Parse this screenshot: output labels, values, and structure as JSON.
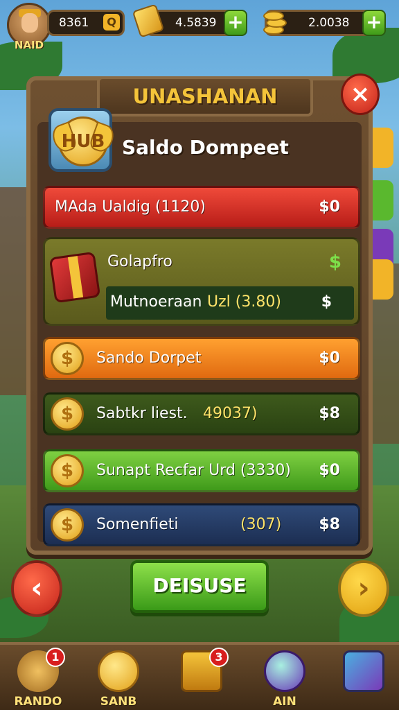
{
  "topbar": {
    "player_name": "NAID",
    "level_value": "8361",
    "level_button": "Q",
    "gold_value": "4.5839",
    "coins_value": "2.0038",
    "plus_label": "+"
  },
  "panel": {
    "title": "UNASHANAN",
    "close_label": "×",
    "hub_badge": "HUB",
    "wallet_title": "Saldo Dompeet"
  },
  "rows": {
    "red": {
      "label": "MAda Ualdig (1120)",
      "amount": "$0"
    },
    "card": {
      "title": "Golapfro",
      "dollar": "$",
      "sub_label": "Mutnoeraan",
      "sub_extra": "Uzl (3.80)",
      "sub_amount": "$"
    },
    "orange": {
      "label": "Sando Dorpet",
      "amount": "$0",
      "coin": "$"
    },
    "dgreen": {
      "label": "Sabtkr liest.",
      "extra": "49037)",
      "amount": "$8",
      "coin": "$"
    },
    "lgreen": {
      "label": "Sunapt Recfar Urd (3330)",
      "amount": "$0",
      "coin": "$"
    },
    "blue": {
      "label": "Somenfieti",
      "extra": "(307)",
      "amount": "$8",
      "coin": "$"
    }
  },
  "controls": {
    "prev_label": "‹",
    "next_label": "›",
    "confirm_label": "DEISUSE"
  },
  "navbar": {
    "items": [
      {
        "label": "RANDO",
        "badge": "1"
      },
      {
        "label": "SANB",
        "badge": ""
      },
      {
        "label": "",
        "badge": "3"
      },
      {
        "label": "AIN",
        "badge": ""
      },
      {
        "label": "",
        "badge": ""
      }
    ]
  },
  "colors": {
    "panel": "#5b4028",
    "gold": "#f4c43a",
    "red_row": "#d33022",
    "orange_row": "#f08a20",
    "green_row": "#5ab82e",
    "blue_row": "#253c66"
  }
}
